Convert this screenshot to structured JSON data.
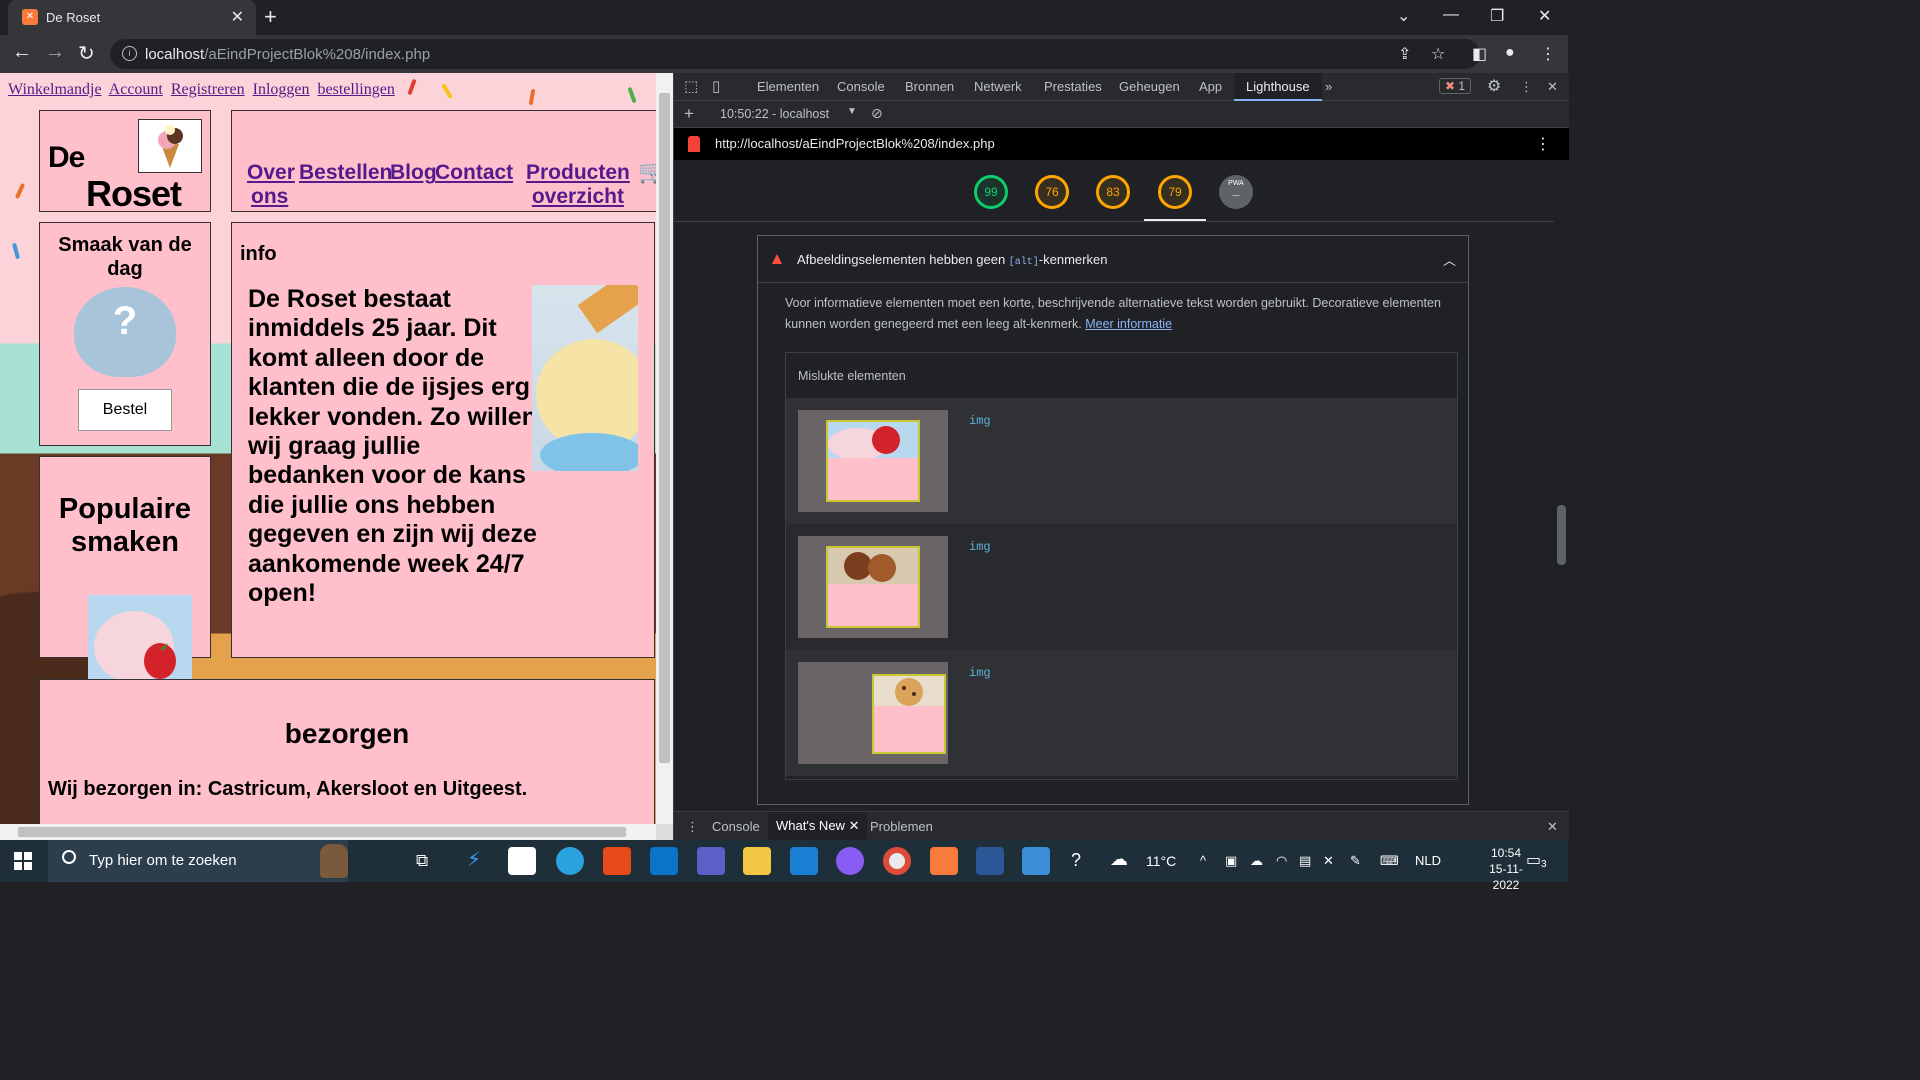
{
  "browser": {
    "tab_title": "De Roset",
    "url_host": "localhost",
    "url_path": "/aEindProjectBlok%208/index.php"
  },
  "site": {
    "top_links": [
      "Winkelmandje",
      "Account",
      "Registreren",
      "Inloggen",
      "bestellingen"
    ],
    "logo": {
      "line1": "De",
      "line2": "Roset"
    },
    "nav": {
      "over_line1": "Over",
      "over_line2": "ons",
      "bestellen": "Bestellen",
      "blog": "Blog",
      "contact": "Contact",
      "producten_line1": "Producten",
      "producten_line2": "overzicht"
    },
    "smaak_title": "Smaak van de dag",
    "smaak_question": "?",
    "bestel_button": "Bestel",
    "populaire_title": "Populaire smaken",
    "info_heading": "info",
    "info_text": "De Roset bestaat inmiddels 25 jaar. Dit komt alleen door de klanten die de ijsjes erg lekker vonden. Zo willen wij graag jullie bedanken voor de kans die jullie ons hebben gegeven en zijn wij deze aankomende week 24/7 open!",
    "bezorgen_heading": "bezorgen",
    "bezorgen_text": "Wij bezorgen in: Castricum, Akersloot en Uitgeest."
  },
  "devtools": {
    "tabs": [
      "Elementen",
      "Console",
      "Bronnen",
      "Netwerk",
      "Prestaties",
      "Geheugen",
      "App",
      "Lighthouse"
    ],
    "active_tab": "Lighthouse",
    "error_count": "1",
    "report_select": "10:50:22 - localhost",
    "lighthouse_url": "http://localhost/aEindProjectBlok%208/index.php",
    "scores": [
      "99",
      "76",
      "83",
      "79"
    ],
    "pwa_label": "PWA",
    "audit": {
      "title_before": "Afbeeldingselementen hebben geen ",
      "title_code": "[alt]",
      "title_after": "-kenmerken",
      "description": "Voor informatieve elementen moet een korte, beschrijvende alternatieve tekst worden gebruikt. Decoratieve elementen kunnen worden genegeerd met een leeg alt-kenmerk.",
      "more_link": "Meer informatie",
      "failed_header": "Mislukte elementen",
      "nodes": [
        "img",
        "img",
        "img"
      ]
    },
    "drawer_tabs": [
      "Console",
      "What's New",
      "Problemen"
    ]
  },
  "taskbar": {
    "search_placeholder": "Typ hier om te zoeken",
    "weather": "11°C",
    "language": "NLD",
    "time": "10:54",
    "date": "15-11-2022",
    "notifications": "3"
  },
  "colors": {
    "site_box_bg": "#ffc0cb",
    "link_visited": "#551a8b",
    "devtools_bg": "#202124",
    "score_green": "#0cce6b",
    "score_orange": "#ffa400",
    "fail_red": "#ff4e42"
  }
}
